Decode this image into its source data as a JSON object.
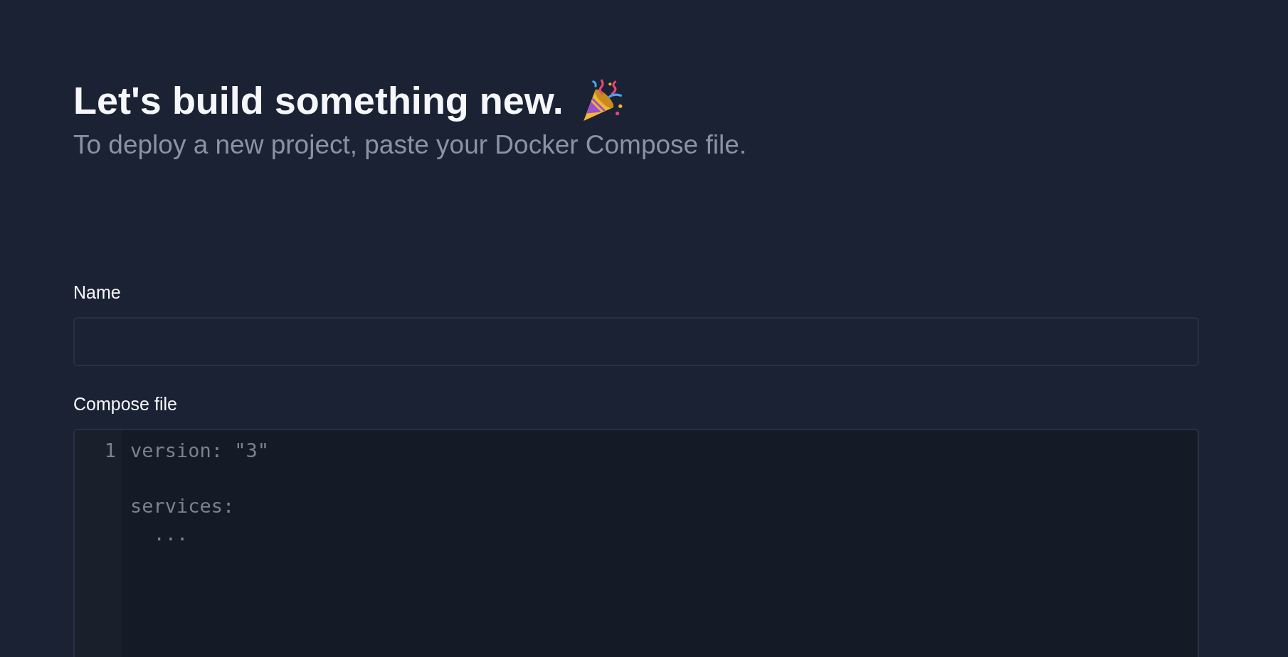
{
  "heading": "Let's build something new.",
  "subheading": "To deploy a new project, paste your Docker Compose file.",
  "fields": [
    {
      "kind": "text",
      "label": "Name"
    },
    {
      "kind": "code",
      "label": "Compose file",
      "line_numbers": [
        "1"
      ],
      "placeholder": "version: \"3\"\n\nservices:\n  ..."
    }
  ]
}
